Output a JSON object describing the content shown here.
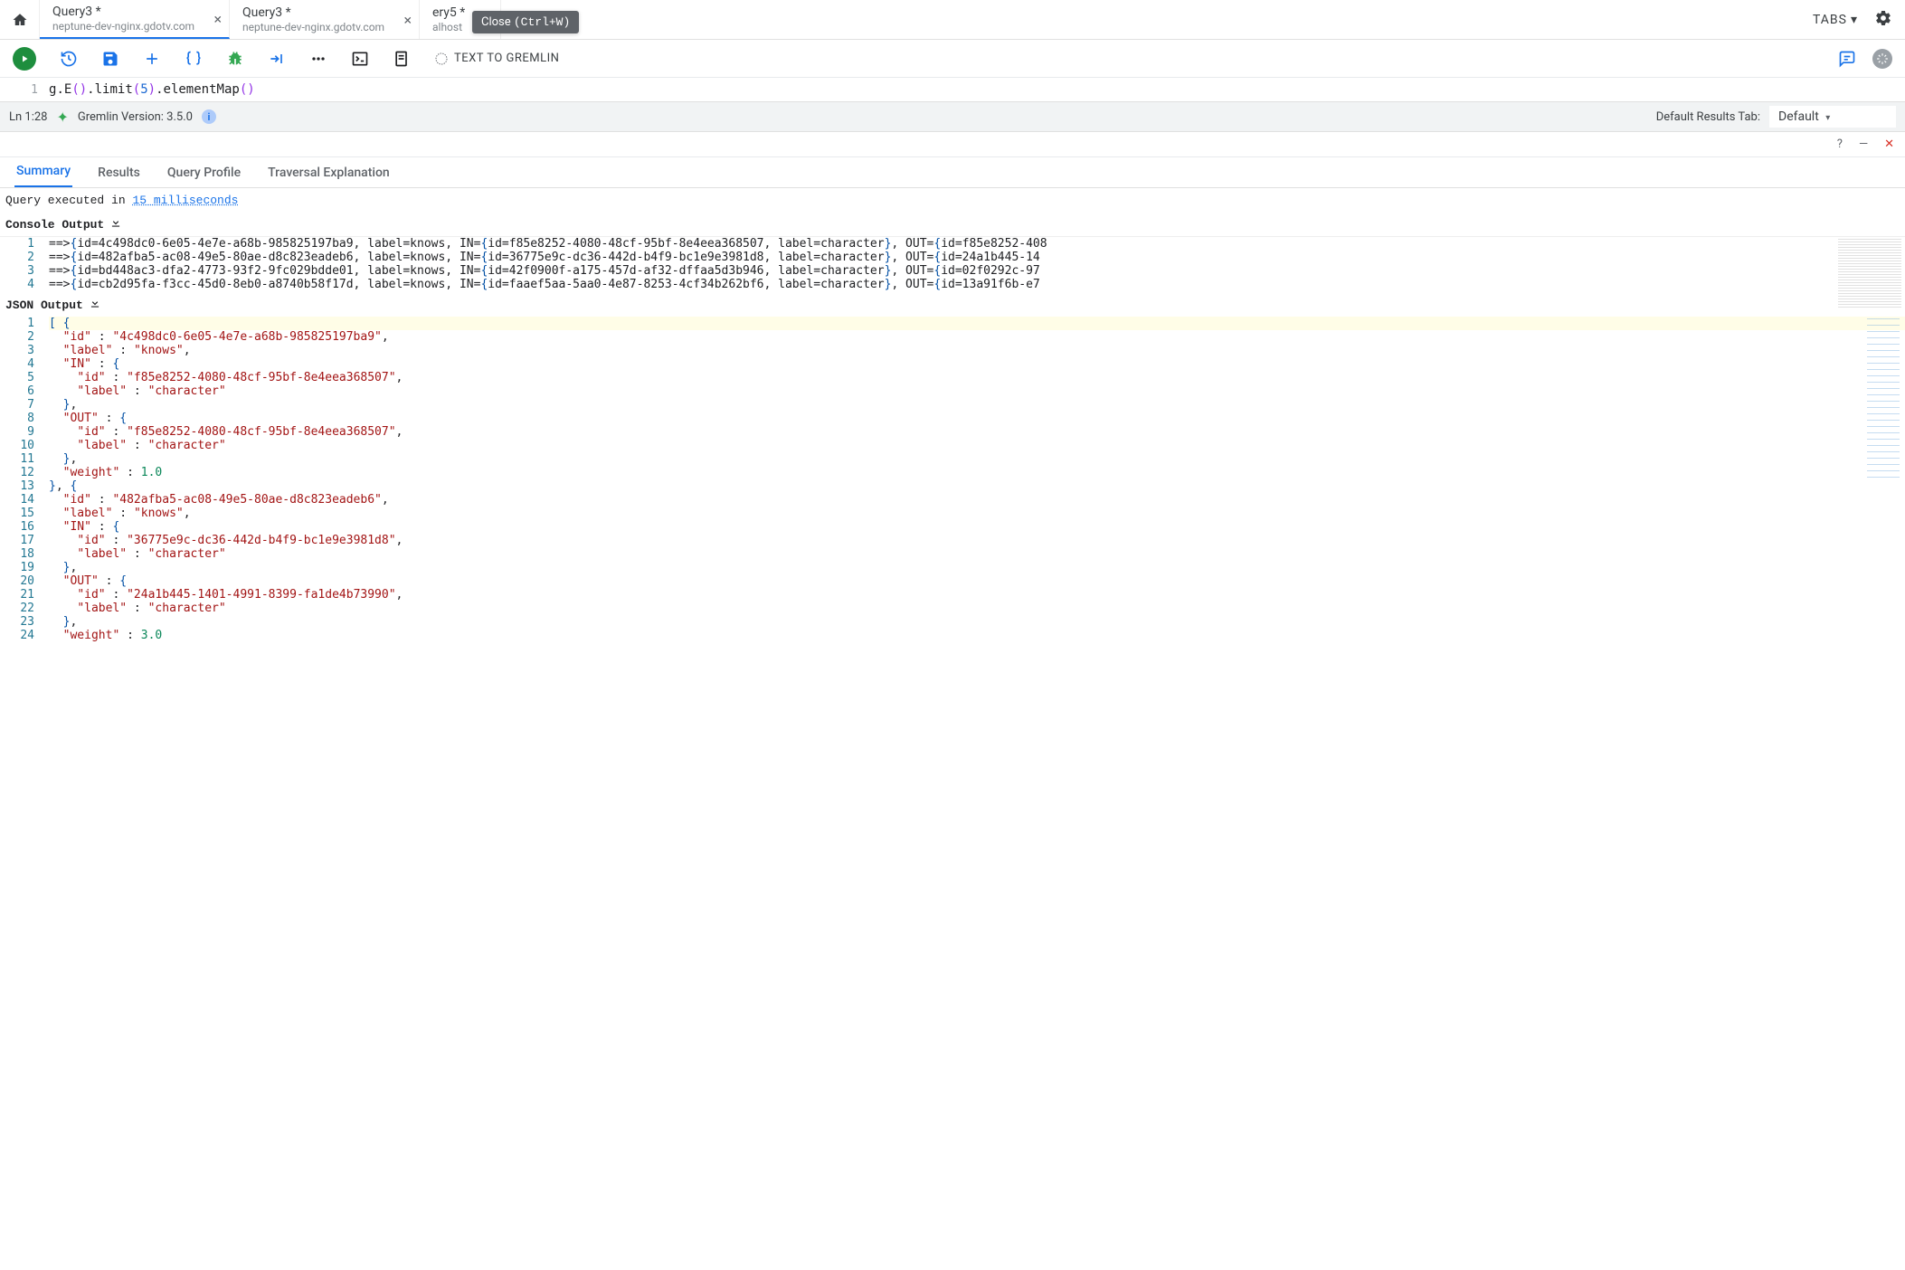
{
  "tabs": [
    {
      "title": "Query3 *",
      "sub": "neptune-dev-nginx.gdotv.com",
      "active": true
    },
    {
      "title": "Query3 *",
      "sub": "neptune-dev-nginx.gdotv.com",
      "active": false
    },
    {
      "title": "ery5 *",
      "sub": "alhost",
      "active": false,
      "closeColor": "blue"
    }
  ],
  "tooltip": {
    "label": "Close",
    "shortcut": "(Ctrl+W)"
  },
  "tabsMenu": "TABS",
  "toolbar": {
    "textToGremlin": "TEXT TO GREMLIN"
  },
  "editor": {
    "line": "1",
    "code_tokens": [
      {
        "t": "g",
        "c": "k"
      },
      {
        "t": ".",
        "c": "k"
      },
      {
        "t": "E",
        "c": "k"
      },
      {
        "t": "()",
        "c": "p"
      },
      {
        "t": ".",
        "c": "k"
      },
      {
        "t": "limit",
        "c": "k"
      },
      {
        "t": "(",
        "c": "p"
      },
      {
        "t": "5",
        "c": "n"
      },
      {
        "t": ")",
        "c": "p"
      },
      {
        "t": ".",
        "c": "k"
      },
      {
        "t": "elementMap",
        "c": "k"
      },
      {
        "t": "()",
        "c": "p"
      }
    ]
  },
  "status": {
    "pos": "Ln 1:28",
    "version": "Gremlin Version: 3.5.0",
    "defaultTabLabel": "Default Results Tab:",
    "defaultTabValue": "Default"
  },
  "resultTabs": [
    "Summary",
    "Results",
    "Query Profile",
    "Traversal Explanation"
  ],
  "exec": {
    "prefix": "Query executed in ",
    "link": "15 milliseconds"
  },
  "sections": {
    "console": "Console Output",
    "json": "JSON Output"
  },
  "console": [
    "==>{id=4c498dc0-6e05-4e7e-a68b-985825197ba9, label=knows, IN={id=f85e8252-4080-48cf-95bf-8e4eea368507, label=character}, OUT={id=f85e8252-408",
    "==>{id=482afba5-ac08-49e5-80ae-d8c823eadeb6, label=knows, IN={id=36775e9c-dc36-442d-b4f9-bc1e9e3981d8, label=character}, OUT={id=24a1b445-14",
    "==>{id=bd448ac3-dfa2-4773-93f2-9fc029bdde01, label=knows, IN={id=42f0900f-a175-457d-af32-dffaa5d3b946, label=character}, OUT={id=02f0292c-97",
    "==>{id=cb2d95fa-f3cc-45d0-8eb0-a8740b58f17d, label=knows, IN={id=faaef5aa-5aa0-4e87-8253-4cf34b262bf6, label=character}, OUT={id=13a91f6b-e7"
  ],
  "json_lines": [
    {
      "n": 1,
      "seg": [
        {
          "t": "[ ",
          "c": "jp"
        },
        {
          "t": "{",
          "c": "jp"
        }
      ]
    },
    {
      "n": 2,
      "seg": [
        {
          "t": "  "
        },
        {
          "t": "\"id\"",
          "c": "jk"
        },
        {
          "t": " : "
        },
        {
          "t": "\"4c498dc0-6e05-4e7e-a68b-985825197ba9\"",
          "c": "jk"
        },
        {
          "t": ","
        }
      ]
    },
    {
      "n": 3,
      "seg": [
        {
          "t": "  "
        },
        {
          "t": "\"label\"",
          "c": "jk"
        },
        {
          "t": " : "
        },
        {
          "t": "\"knows\"",
          "c": "jk"
        },
        {
          "t": ","
        }
      ]
    },
    {
      "n": 4,
      "seg": [
        {
          "t": "  "
        },
        {
          "t": "\"IN\"",
          "c": "jk"
        },
        {
          "t": " : "
        },
        {
          "t": "{",
          "c": "jp"
        }
      ]
    },
    {
      "n": 5,
      "seg": [
        {
          "t": "    "
        },
        {
          "t": "\"id\"",
          "c": "jk"
        },
        {
          "t": " : "
        },
        {
          "t": "\"f85e8252-4080-48cf-95bf-8e4eea368507\"",
          "c": "jk"
        },
        {
          "t": ","
        }
      ]
    },
    {
      "n": 6,
      "seg": [
        {
          "t": "    "
        },
        {
          "t": "\"label\"",
          "c": "jk"
        },
        {
          "t": " : "
        },
        {
          "t": "\"character\"",
          "c": "jk"
        }
      ]
    },
    {
      "n": 7,
      "seg": [
        {
          "t": "  "
        },
        {
          "t": "}",
          "c": "jp"
        },
        {
          "t": ","
        }
      ]
    },
    {
      "n": 8,
      "seg": [
        {
          "t": "  "
        },
        {
          "t": "\"OUT\"",
          "c": "jk"
        },
        {
          "t": " : "
        },
        {
          "t": "{",
          "c": "jp"
        }
      ]
    },
    {
      "n": 9,
      "seg": [
        {
          "t": "    "
        },
        {
          "t": "\"id\"",
          "c": "jk"
        },
        {
          "t": " : "
        },
        {
          "t": "\"f85e8252-4080-48cf-95bf-8e4eea368507\"",
          "c": "jk"
        },
        {
          "t": ","
        }
      ]
    },
    {
      "n": 10,
      "seg": [
        {
          "t": "    "
        },
        {
          "t": "\"label\"",
          "c": "jk"
        },
        {
          "t": " : "
        },
        {
          "t": "\"character\"",
          "c": "jk"
        }
      ]
    },
    {
      "n": 11,
      "seg": [
        {
          "t": "  "
        },
        {
          "t": "}",
          "c": "jp"
        },
        {
          "t": ","
        }
      ]
    },
    {
      "n": 12,
      "seg": [
        {
          "t": "  "
        },
        {
          "t": "\"weight\"",
          "c": "jk"
        },
        {
          "t": " : "
        },
        {
          "t": "1.0",
          "c": "jn"
        }
      ]
    },
    {
      "n": 13,
      "seg": [
        {
          "t": "}",
          "c": "jp"
        },
        {
          "t": ", "
        },
        {
          "t": "{",
          "c": "jp"
        }
      ]
    },
    {
      "n": 14,
      "seg": [
        {
          "t": "  "
        },
        {
          "t": "\"id\"",
          "c": "jk"
        },
        {
          "t": " : "
        },
        {
          "t": "\"482afba5-ac08-49e5-80ae-d8c823eadeb6\"",
          "c": "jk"
        },
        {
          "t": ","
        }
      ]
    },
    {
      "n": 15,
      "seg": [
        {
          "t": "  "
        },
        {
          "t": "\"label\"",
          "c": "jk"
        },
        {
          "t": " : "
        },
        {
          "t": "\"knows\"",
          "c": "jk"
        },
        {
          "t": ","
        }
      ]
    },
    {
      "n": 16,
      "seg": [
        {
          "t": "  "
        },
        {
          "t": "\"IN\"",
          "c": "jk"
        },
        {
          "t": " : "
        },
        {
          "t": "{",
          "c": "jp"
        }
      ]
    },
    {
      "n": 17,
      "seg": [
        {
          "t": "    "
        },
        {
          "t": "\"id\"",
          "c": "jk"
        },
        {
          "t": " : "
        },
        {
          "t": "\"36775e9c-dc36-442d-b4f9-bc1e9e3981d8\"",
          "c": "jk"
        },
        {
          "t": ","
        }
      ]
    },
    {
      "n": 18,
      "seg": [
        {
          "t": "    "
        },
        {
          "t": "\"label\"",
          "c": "jk"
        },
        {
          "t": " : "
        },
        {
          "t": "\"character\"",
          "c": "jk"
        }
      ]
    },
    {
      "n": 19,
      "seg": [
        {
          "t": "  "
        },
        {
          "t": "}",
          "c": "jp"
        },
        {
          "t": ","
        }
      ]
    },
    {
      "n": 20,
      "seg": [
        {
          "t": "  "
        },
        {
          "t": "\"OUT\"",
          "c": "jk"
        },
        {
          "t": " : "
        },
        {
          "t": "{",
          "c": "jp"
        }
      ]
    },
    {
      "n": 21,
      "seg": [
        {
          "t": "    "
        },
        {
          "t": "\"id\"",
          "c": "jk"
        },
        {
          "t": " : "
        },
        {
          "t": "\"24a1b445-1401-4991-8399-fa1de4b73990\"",
          "c": "jk"
        },
        {
          "t": ","
        }
      ]
    },
    {
      "n": 22,
      "seg": [
        {
          "t": "    "
        },
        {
          "t": "\"label\"",
          "c": "jk"
        },
        {
          "t": " : "
        },
        {
          "t": "\"character\"",
          "c": "jk"
        }
      ]
    },
    {
      "n": 23,
      "seg": [
        {
          "t": "  "
        },
        {
          "t": "}",
          "c": "jp"
        },
        {
          "t": ","
        }
      ]
    },
    {
      "n": 24,
      "seg": [
        {
          "t": "  "
        },
        {
          "t": "\"weight\"",
          "c": "jk"
        },
        {
          "t": " : "
        },
        {
          "t": "3.0",
          "c": "jn"
        }
      ]
    }
  ]
}
